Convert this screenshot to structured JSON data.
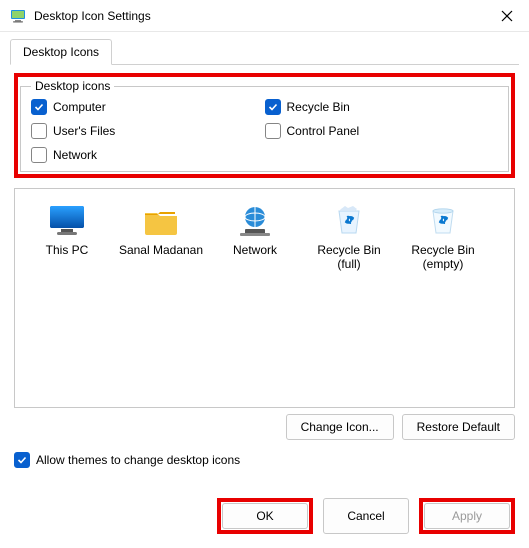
{
  "window": {
    "title": "Desktop Icon Settings"
  },
  "tab": {
    "label": "Desktop Icons"
  },
  "group": {
    "legend": "Desktop icons",
    "items": [
      {
        "label": "Computer",
        "checked": true
      },
      {
        "label": "User's Files",
        "checked": false
      },
      {
        "label": "Network",
        "checked": false
      },
      {
        "label": "Recycle Bin",
        "checked": true
      },
      {
        "label": "Control Panel",
        "checked": false
      }
    ]
  },
  "preview": {
    "items": [
      {
        "label": "This PC"
      },
      {
        "label": "Sanal Madanan"
      },
      {
        "label": "Network"
      },
      {
        "label": "Recycle Bin (full)"
      },
      {
        "label": "Recycle Bin (empty)"
      }
    ],
    "change_icon": "Change Icon...",
    "restore_default": "Restore Default"
  },
  "allow_themes": {
    "label": "Allow themes to change desktop icons",
    "checked": true
  },
  "buttons": {
    "ok": "OK",
    "cancel": "Cancel",
    "apply": "Apply"
  }
}
